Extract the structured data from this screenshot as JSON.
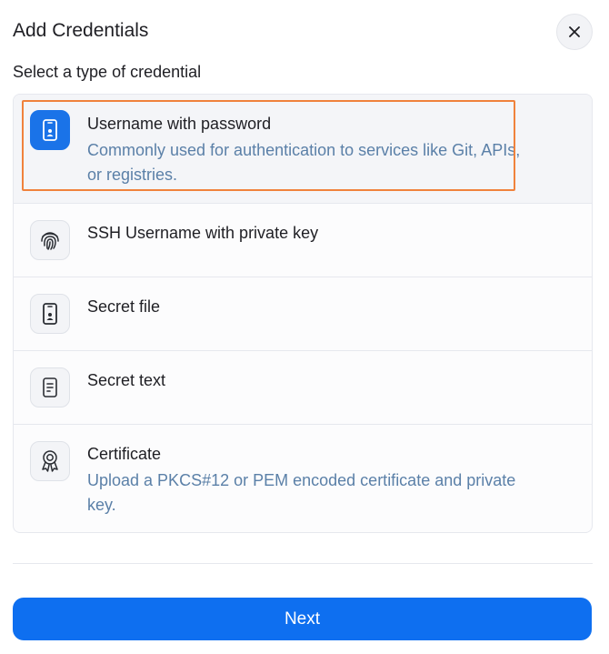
{
  "dialog": {
    "title": "Add Credentials",
    "subtitle": "Select a type of credential"
  },
  "credential_types": [
    {
      "title": "Username with password",
      "description": "Commonly used for authentication to services like Git, APIs, or registries.",
      "icon": "phone-user-icon",
      "selected": true
    },
    {
      "title": "SSH Username with private key",
      "description": "",
      "icon": "fingerprint-icon",
      "selected": false
    },
    {
      "title": "Secret file",
      "description": "",
      "icon": "phone-user-icon",
      "selected": false
    },
    {
      "title": "Secret text",
      "description": "",
      "icon": "document-icon",
      "selected": false
    },
    {
      "title": "Certificate",
      "description": "Upload a PKCS#12 or PEM encoded certificate and private key.",
      "icon": "certificate-badge-icon",
      "selected": false
    }
  ],
  "footer": {
    "next_label": "Next"
  },
  "colors": {
    "accent": "#0e6ff0",
    "selected_icon_bg": "#1a73e8",
    "description_text": "#5b80a8",
    "highlight_outline": "#f0823c"
  }
}
